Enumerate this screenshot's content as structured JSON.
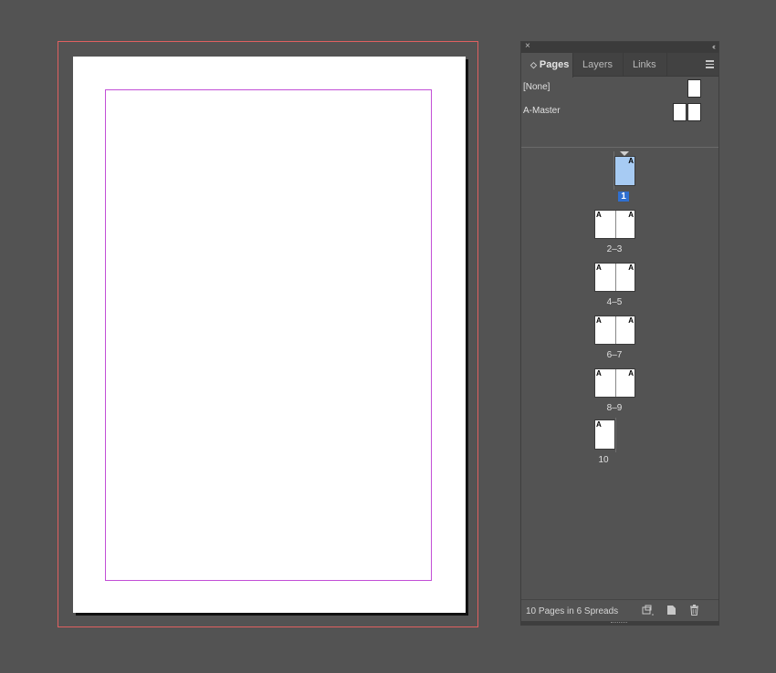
{
  "panel": {
    "close_icon": "×",
    "collapse_icon": "‹‹",
    "tabs": [
      {
        "label": "Pages",
        "active": true
      },
      {
        "label": "Layers",
        "active": false
      },
      {
        "label": "Links",
        "active": false
      }
    ],
    "updown_icon": "◇",
    "masters": [
      {
        "label": "[None]"
      },
      {
        "label": "A-Master"
      }
    ],
    "pages": [
      {
        "label": "1",
        "selected": true,
        "prefix": "A"
      },
      {
        "label": "2–3",
        "prefix": "A"
      },
      {
        "label": "4–5",
        "prefix": "A"
      },
      {
        "label": "6–7",
        "prefix": "A"
      },
      {
        "label": "8–9",
        "prefix": "A"
      },
      {
        "label": "10",
        "prefix": "A"
      }
    ],
    "status": "10 Pages in 6 Spreads"
  },
  "colors": {
    "pasteboard": "#535353",
    "bleed_guide": "#e06060",
    "margin_guide": "#c24fd6",
    "selection": "#2f6fd0",
    "selected_thumb": "#a7cbf3"
  }
}
